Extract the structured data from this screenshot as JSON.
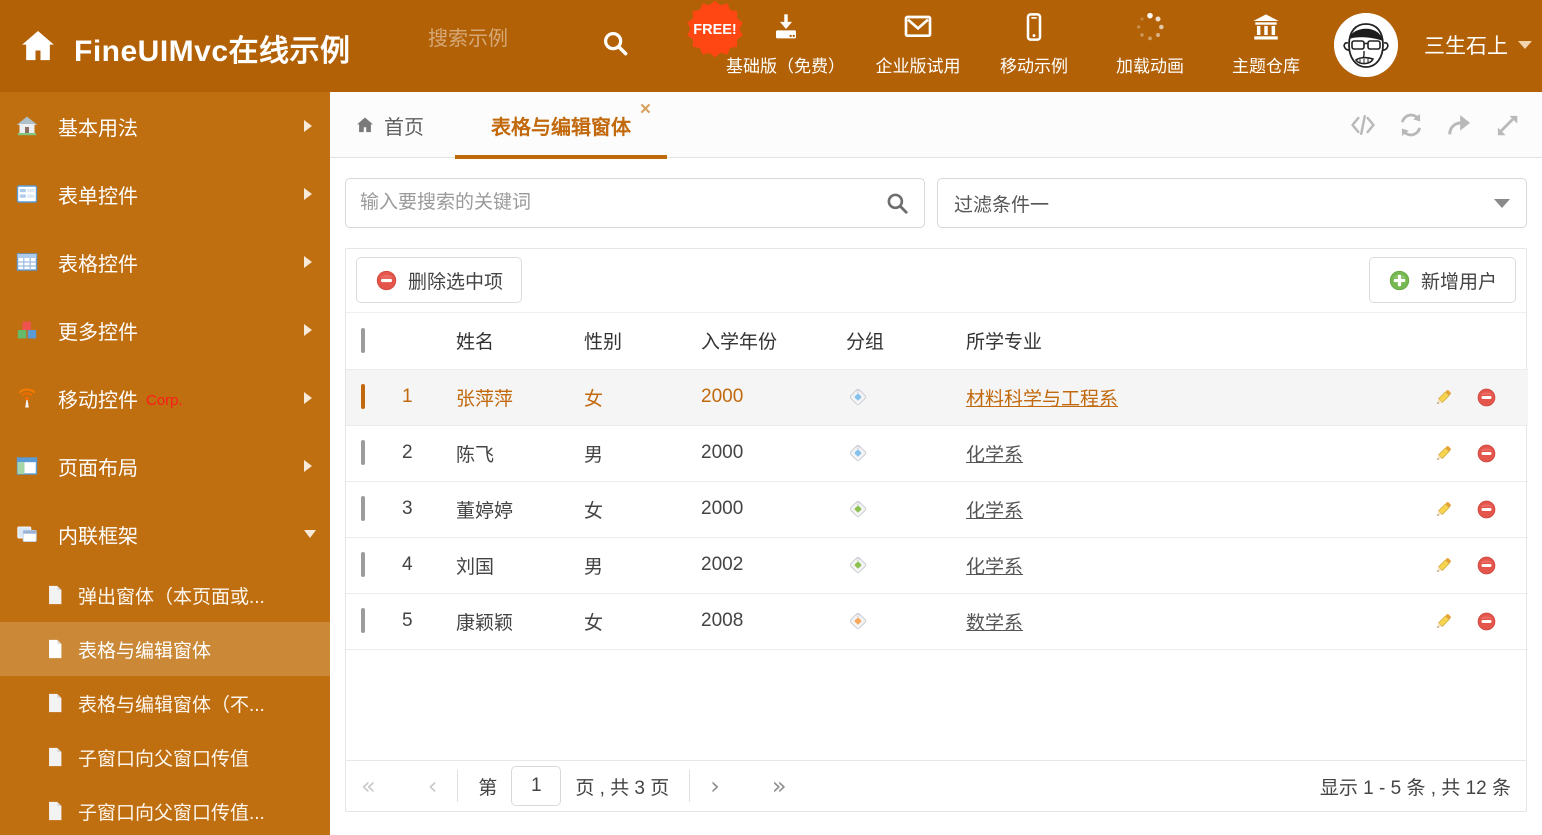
{
  "theme": {
    "header_bg": "#b26106",
    "sidebar_bg": "#bf6e10",
    "sidebar_active_bg": "#cb8836",
    "accent": "#c1690c",
    "free_badge_bg": "#ff4713",
    "tag_colors": {
      "blue": "#85c1ed",
      "green": "#8cc152",
      "orange": "#f6a85f"
    }
  },
  "glyphs": {
    "close": "×",
    "pager_first": "«",
    "pager_prev": "‹",
    "pager_next": "›",
    "pager_last": "»"
  },
  "header": {
    "app_title": "FineUIMvc在线示例",
    "search_placeholder": "搜索示例",
    "free_badge": "FREE!",
    "nav": [
      {
        "label": "基础版（免费）",
        "icon": "download-icon"
      },
      {
        "label": "企业版试用",
        "icon": "envelope-icon"
      },
      {
        "label": "移动示例",
        "icon": "mobile-icon"
      },
      {
        "label": "加载动画",
        "icon": "spinner-icon"
      },
      {
        "label": "主题仓库",
        "icon": "bank-icon"
      }
    ],
    "user_name": "三生石上"
  },
  "sidebar": {
    "items": [
      {
        "label": "基本用法",
        "icon": "home-icon"
      },
      {
        "label": "表单控件",
        "icon": "form-icon"
      },
      {
        "label": "表格控件",
        "icon": "table-icon"
      },
      {
        "label": "更多控件",
        "icon": "blocks-icon"
      },
      {
        "label": "移动控件",
        "badge": "Corp.",
        "icon": "antenna-icon"
      },
      {
        "label": "页面布局",
        "icon": "layout-icon"
      },
      {
        "label": "内联框架",
        "icon": "frames-icon",
        "expanded": true
      }
    ],
    "subitems": [
      {
        "label": "弹出窗体（本页面或..."
      },
      {
        "label": "表格与编辑窗体",
        "active": true
      },
      {
        "label": "表格与编辑窗体（不..."
      },
      {
        "label": "子窗口向父窗口传值"
      },
      {
        "label": "子窗口向父窗口传值..."
      }
    ]
  },
  "tabs": {
    "home": "首页",
    "active": "表格与编辑窗体"
  },
  "filter_bar": {
    "search_placeholder": "输入要搜索的关键词",
    "dropdown_value": "过滤条件一"
  },
  "toolbar": {
    "delete_label": "删除选中项",
    "add_label": "新增用户"
  },
  "table": {
    "columns": {
      "name": "姓名",
      "gender": "性别",
      "year": "入学年份",
      "group": "分组",
      "major": "所学专业"
    },
    "rows": [
      {
        "num": "1",
        "name": "张萍萍",
        "gender": "女",
        "year": "2000",
        "tag_color": "blue",
        "major": "材料科学与工程系",
        "highlighted": true
      },
      {
        "num": "2",
        "name": "陈飞",
        "gender": "男",
        "year": "2000",
        "tag_color": "blue",
        "major": "化学系"
      },
      {
        "num": "3",
        "name": "董婷婷",
        "gender": "女",
        "year": "2000",
        "tag_color": "green",
        "major": "化学系"
      },
      {
        "num": "4",
        "name": "刘国",
        "gender": "男",
        "year": "2002",
        "tag_color": "green",
        "major": "化学系"
      },
      {
        "num": "5",
        "name": "康颖颖",
        "gender": "女",
        "year": "2008",
        "tag_color": "orange",
        "major": "数学系"
      }
    ]
  },
  "pagination": {
    "label_page": "第",
    "page_value": "1",
    "label_total": "页 , 共 3 页",
    "summary": "显示 1 - 5 条 , 共 12 条"
  }
}
